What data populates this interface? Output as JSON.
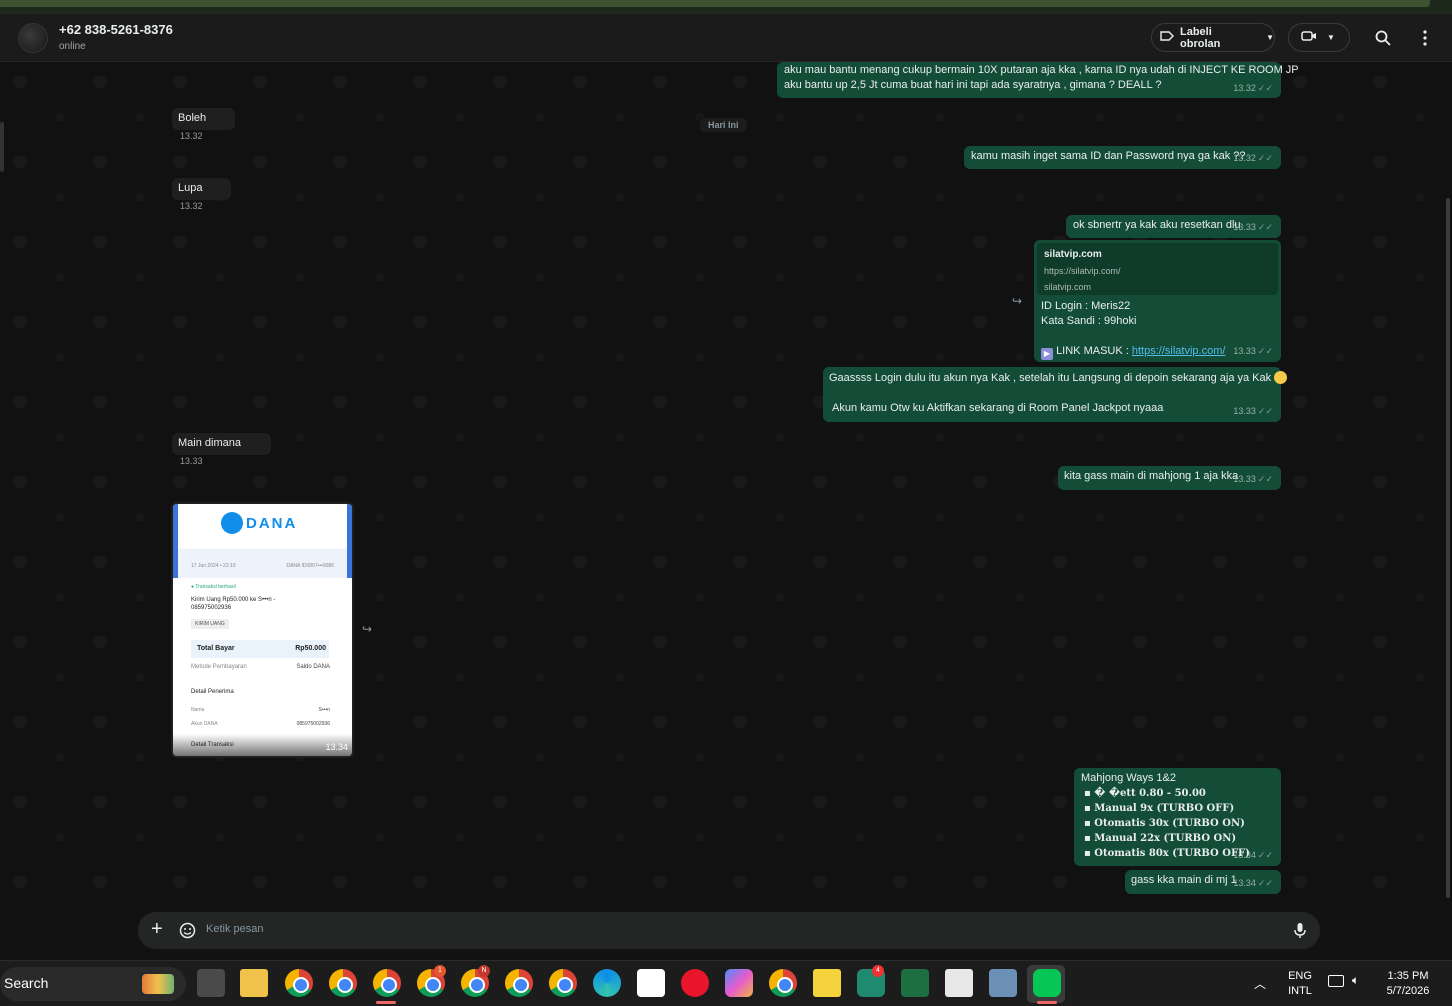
{
  "header": {
    "contact_name": "+62 838-5261-8376",
    "status": "online",
    "label_button": "Labeli obrolan"
  },
  "date_divider": "Hari Ini",
  "messages": {
    "out1_line1": "aku mau bantu menang cukup bermain 10X putaran aja kka , karna ID nya udah di INJECT KE ROOM JP",
    "out1_line2": "aku bantu up 2,5 Jt cuma buat hari ini tapi ada syaratnya , gimana ? DEALL ?",
    "out1_time": "13.32",
    "in1_text": "Boleh",
    "in1_time": "13.32",
    "out2_text": "kamu masih inget sama ID dan Password nya ga kak ??",
    "out2_time": "13.32",
    "in2_text": "Lupa",
    "in2_time": "13.32",
    "out3_text": "ok sbnertr ya kak aku resetkan dlu",
    "out3_time": "13.33",
    "link_title": "silatvip.com",
    "link_url": "https://silatvip.com/",
    "link_domain": "silatvip.com",
    "out4_login": "ID Login : Meris22",
    "out4_pass": "Kata Sandi : 99hoki",
    "out4_link_label": "LINK MASUK   :",
    "out4_link": "https://silatvip.com/",
    "out4_time": "13.33",
    "out5_line1": "Gaassss Login dulu itu akun nya Kak  , setelah itu Langsung di depoin sekarang aja ya Kak",
    "out5_line2": "Akun kamu Otw ku Aktifkan sekarang di Room Panel Jackpot nyaaa",
    "out5_time": "13.33",
    "in3_text": "Main dimana",
    "in3_time": "13.33",
    "out6_text": "kita gass main di mahjong 1 aja kka",
    "out6_time": "13.33",
    "img_time": "13.34",
    "out7_title": "Mahjong Ways 1&2",
    "out7_l1": "� �ett 0.80 - 50.00",
    "out7_l2": "Manual    9x (TURBO OFF)",
    "out7_l3": "Otomatis 30x (TURBO ON)",
    "out7_l4": "Manual    22x (TURBO ON)",
    "out7_l5": "Otomatis 80x (TURBO OFF)",
    "out7_time": "13.34",
    "out8_text": "gass kka main di mj 1",
    "out8_time": "13.34"
  },
  "receipt": {
    "brand": "DANA",
    "date": "17 Jun 2024 • 22:10",
    "ref": "DANA ID0897•••9086",
    "status": "Transaksi berhasil",
    "desc": "Kirim Uang Rp50.000 ke S•••n - 085975002936",
    "tag": "KIRIM UANG",
    "total_label": "Total Bayar",
    "total_value": "Rp50.000",
    "method_label": "Metode Pembayaran",
    "method_value": "Saldo DANA",
    "detail_label": "Detail Penerima",
    "name_label": "Nama",
    "name_value": "S•••n",
    "account_label": "Akun DANA",
    "account_value": "085975002936",
    "trx_label": "Detail Transaksi"
  },
  "composer": {
    "placeholder": "Ketik pesan"
  },
  "taskbar": {
    "search": "Search",
    "lang1": "ENG",
    "lang2": "INTL",
    "time": "1:35 PM",
    "date": "5/7/2026",
    "badge_red": "1",
    "badge_n": "N",
    "badge_4": "4"
  },
  "colors": {
    "outgoing": "#144d37",
    "incoming": "#1f1f1f",
    "link": "#53bdeb"
  }
}
